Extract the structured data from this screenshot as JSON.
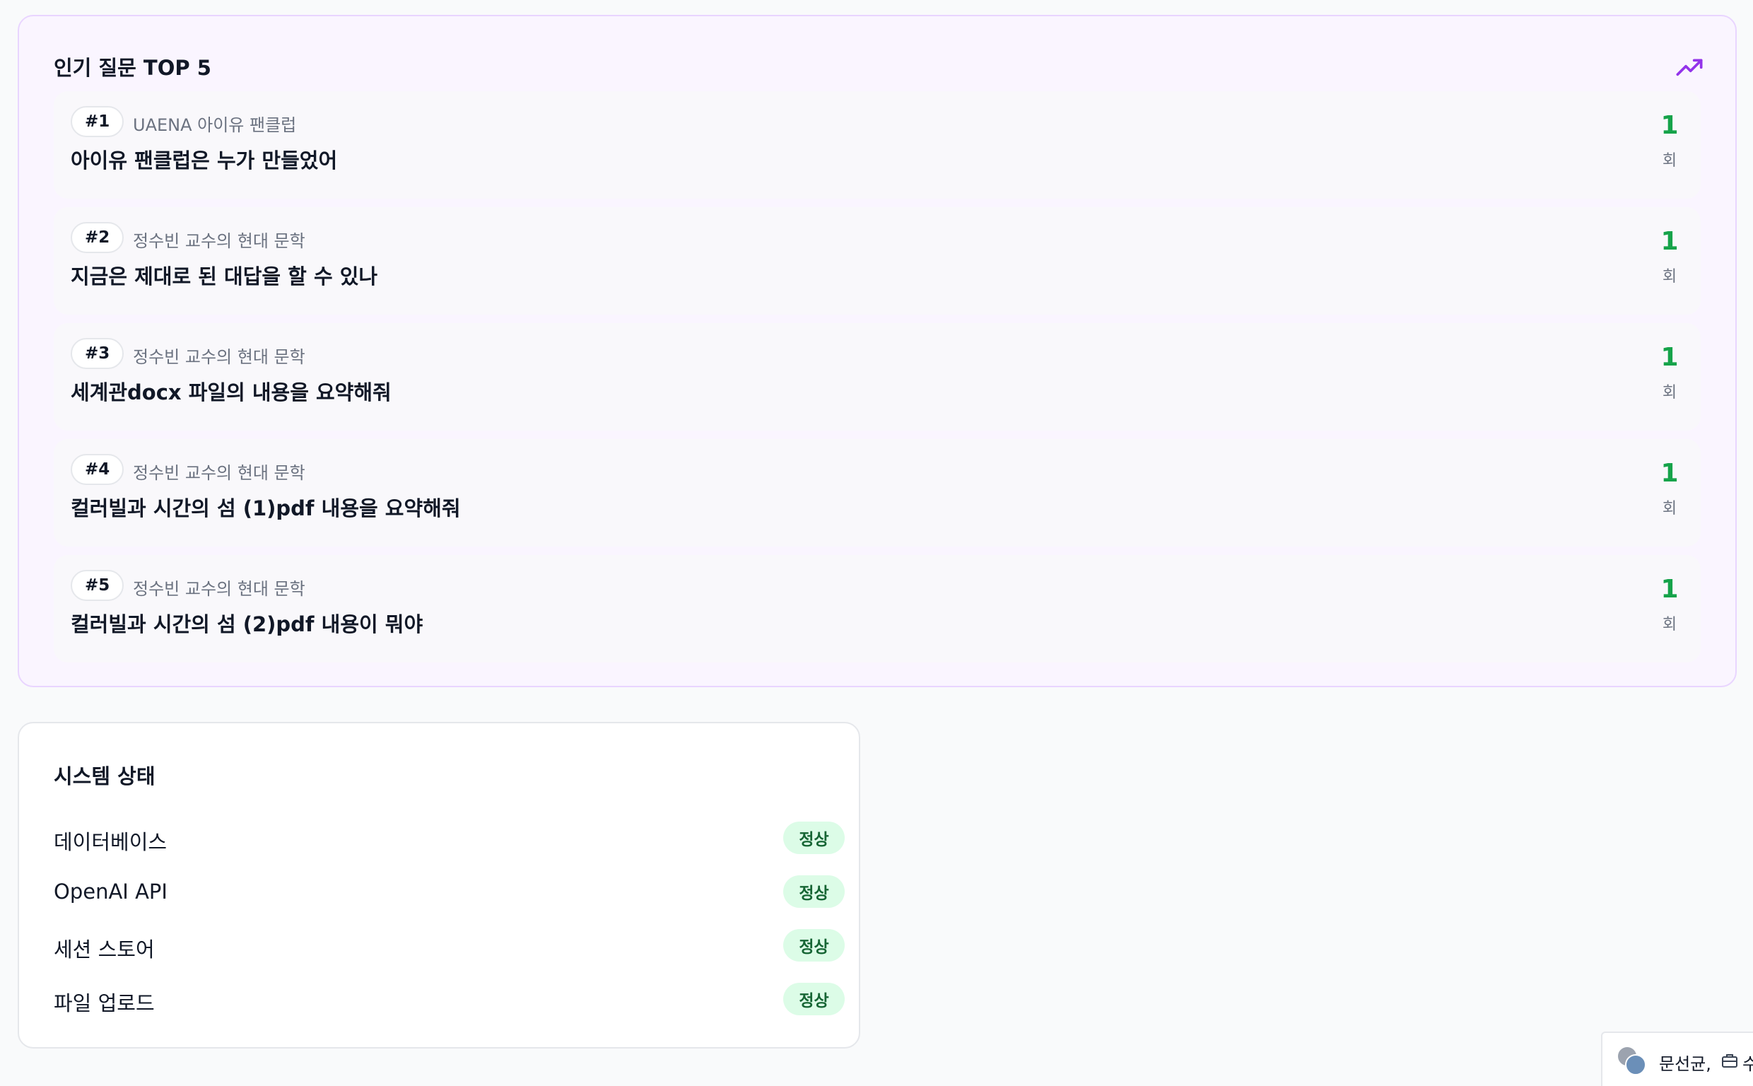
{
  "popular": {
    "title": "인기 질문 TOP 5",
    "icon": "trending-up-icon",
    "accent": "#9333ea",
    "count_color": "#16a34a",
    "items": [
      {
        "rank": "#1",
        "source": "UAENA 아이유 팬클럽",
        "question": "아이유 팬클럽은 누가 만들었어",
        "count": "1",
        "unit": "회"
      },
      {
        "rank": "#2",
        "source": "정수빈 교수의 현대 문학",
        "question": "지금은 제대로 된 대답을 할 수 있나",
        "count": "1",
        "unit": "회"
      },
      {
        "rank": "#3",
        "source": "정수빈 교수의 현대 문학",
        "question": "세계관docx 파일의 내용을 요약해줘",
        "count": "1",
        "unit": "회"
      },
      {
        "rank": "#4",
        "source": "정수빈 교수의 현대 문학",
        "question": "컬러빌과 시간의 섬 (1)pdf 내용을 요약해줘",
        "count": "1",
        "unit": "회"
      },
      {
        "rank": "#5",
        "source": "정수빈 교수의 현대 문학",
        "question": "컬러빌과 시간의 섬 (2)pdf 내용이 뭐야",
        "count": "1",
        "unit": "회"
      }
    ]
  },
  "system": {
    "title": "시스템 상태",
    "status_color": "#166534",
    "status_bg": "#dcfce7",
    "rows": [
      {
        "label": "데이터베이스",
        "status": "정상"
      },
      {
        "label": "OpenAI API",
        "status": "정상"
      },
      {
        "label": "세션 스토어",
        "status": "정상"
      },
      {
        "label": "파일 업로드",
        "status": "정상"
      }
    ]
  },
  "user_chip": {
    "name": "문선균,",
    "extra": "수",
    "icon": "briefcase-icon"
  }
}
